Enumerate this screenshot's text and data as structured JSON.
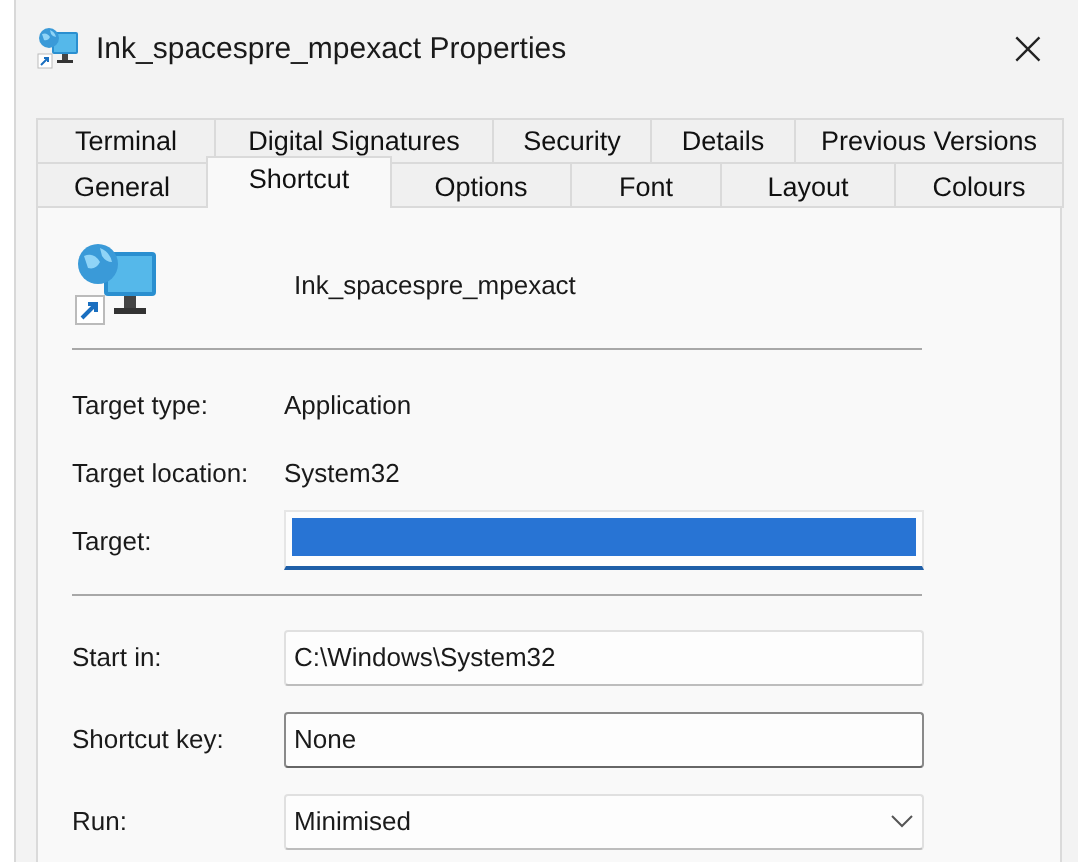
{
  "window": {
    "title": "Ink_spacespre_mpexact Properties",
    "close": "×"
  },
  "tab_rows": [
    [
      {
        "label": "Terminal",
        "selected": false
      },
      {
        "label": "Digital Signatures",
        "selected": false
      },
      {
        "label": "Security",
        "selected": false
      },
      {
        "label": "Details",
        "selected": false
      },
      {
        "label": "Previous Versions",
        "selected": false
      }
    ],
    [
      {
        "label": "General",
        "selected": false
      },
      {
        "label": "Shortcut",
        "selected": true
      },
      {
        "label": "Options",
        "selected": false
      },
      {
        "label": "Font",
        "selected": false
      },
      {
        "label": "Layout",
        "selected": false
      },
      {
        "label": "Colours",
        "selected": false
      }
    ]
  ],
  "shortcut_name": "Ink_spacespre_mpexact",
  "info": [
    {
      "label": "Target type:",
      "value": "Application"
    },
    {
      "label": "Target location:",
      "value": "System32"
    }
  ],
  "target": {
    "label": "Target:",
    "selected": true,
    "focused": true
  },
  "fields": [
    {
      "kind": "text",
      "label": "Start in:",
      "value": "C:\\Windows\\System32"
    },
    {
      "kind": "key",
      "label": "Shortcut key:",
      "value": "None"
    },
    {
      "kind": "select",
      "label": "Run:",
      "value": "Minimised"
    }
  ]
}
